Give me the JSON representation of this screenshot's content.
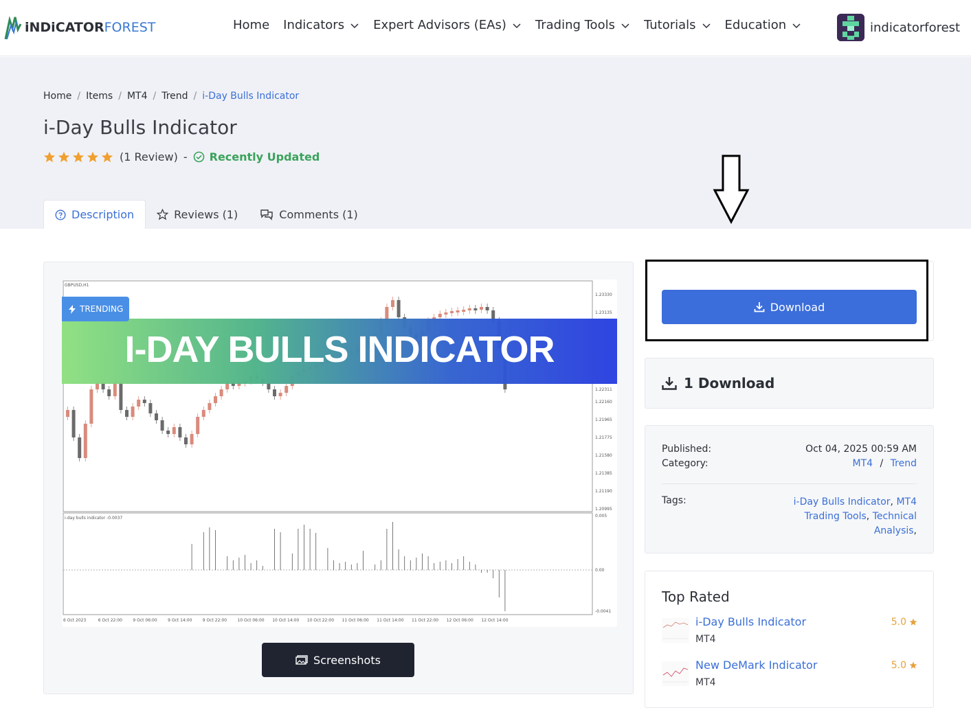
{
  "header": {
    "logo_text_a": "iNDiCATOR",
    "logo_text_b": "FOREST",
    "nav": [
      {
        "label": "Home",
        "has_menu": false
      },
      {
        "label": "Indicators",
        "has_menu": true
      },
      {
        "label": "Expert Advisors (EAs)",
        "has_menu": true
      },
      {
        "label": "Trading Tools",
        "has_menu": true
      },
      {
        "label": "Tutorials",
        "has_menu": true
      },
      {
        "label": "Education",
        "has_menu": true
      }
    ],
    "user_name": "indicatorforest"
  },
  "breadcrumb": {
    "items": [
      "Home",
      "Items",
      "MT4",
      "Trend"
    ],
    "current": "i-Day Bulls Indicator",
    "separator": "/"
  },
  "product": {
    "title": "i-Day Bulls Indicator",
    "rating_stars": 5,
    "review_count": "(1 Review)",
    "dash": "-",
    "updated_label": "Recently Updated"
  },
  "tabs": [
    {
      "label": "Description",
      "active": true,
      "icon": "question-circle-icon"
    },
    {
      "label": "Reviews (1)",
      "active": false,
      "icon": "star-outline-icon"
    },
    {
      "label": "Comments (1)",
      "active": false,
      "icon": "chat-bubbles-icon"
    }
  ],
  "preview": {
    "trending_label": "TRENDING",
    "banner_title": "I-DAY BULLS INDICATOR",
    "chart_symbol": "GBPUSD,H1",
    "indicator_label": "i-day bulls indicator -0.0037",
    "price_ticks": [
      "1.23330",
      "1.23135",
      "1.22311",
      "1.22160",
      "1.21965",
      "1.21775",
      "1.21580",
      "1.21385",
      "1.21190",
      "1.20995"
    ],
    "indicator_ticks": [
      "0.005",
      "0.00",
      "-0.0041"
    ],
    "time_ticks": [
      "6 Oct 2023",
      "6 Oct 22:00",
      "9 Oct 06:00",
      "9 Oct 14:00",
      "9 Oct 22:00",
      "10 Oct 06:00",
      "10 Oct 14:00",
      "10 Oct 22:00",
      "11 Oct 06:00",
      "11 Oct 14:00",
      "11 Oct 22:00",
      "12 Oct 06:00",
      "12 Oct 14:00"
    ],
    "screenshots_label": "Screenshots"
  },
  "sidebar": {
    "download_label": "Download",
    "download_count": "1 Download",
    "published_label": "Published:",
    "published_value": "Oct 04, 2025 00:59 AM",
    "category_label": "Category:",
    "category_links": [
      "MT4",
      "Trend"
    ],
    "category_sep": "/",
    "tags_label": "Tags:",
    "tags": [
      "i-Day Bulls Indicator",
      "MT4 Trading Tools",
      "Technical Analysis"
    ],
    "top_rated_title": "Top Rated",
    "top_rated": [
      {
        "name": "i-Day Bulls Indicator",
        "category": "MT4",
        "score": "5.0"
      },
      {
        "name": "New DeMark Indicator",
        "category": "MT4",
        "score": "5.0"
      }
    ]
  },
  "colors": {
    "primary": "#3b6ddb",
    "dark_button": "#1f2430",
    "star": "#f0a030",
    "success": "#3aa35b",
    "hero_bg": "#f0f1f6"
  }
}
